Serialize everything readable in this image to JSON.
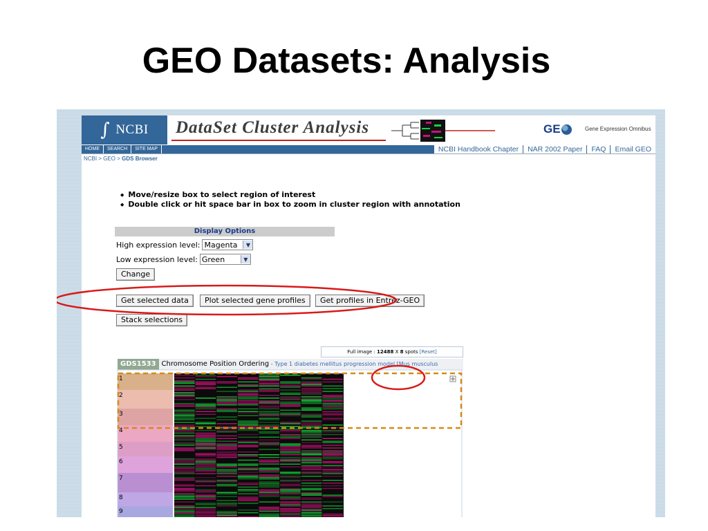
{
  "slide": {
    "title": "GEO Datasets: Analysis"
  },
  "banner": {
    "ncbi_logo": "NCBI",
    "tool_title": "DataSet Cluster Analysis",
    "geo_logo": "GE",
    "geo_subtitle": "Gene Expression Omnibus"
  },
  "nav": {
    "left": [
      "HOME",
      "SEARCH",
      "SITE MAP"
    ],
    "right": [
      "NCBI Handbook Chapter",
      "NAR 2002 Paper",
      "FAQ",
      "Email GEO"
    ]
  },
  "breadcrumb": {
    "path": "NCBI > GEO > ",
    "current": "GDS Browser"
  },
  "instructions": [
    "Move/resize box to select region of interest",
    "Double click or hit space bar in box to zoom in cluster region with annotation"
  ],
  "display_options": {
    "heading": "Display Options",
    "high_label": "High expression level:",
    "high_value": "Magenta",
    "low_label": "Low expression level:",
    "low_value": "Green",
    "change_button": "Change"
  },
  "actions": {
    "get_selected_data": "Get selected data",
    "plot_selected": "Plot selected gene profiles",
    "get_profiles": "Get profiles in Entrez-GEO",
    "stack_selections": "Stack selections"
  },
  "image_info": {
    "prefix": "Full image : ",
    "count": "12488",
    "mid": " X ",
    "cols": "8",
    "suffix": " spots ",
    "reset": "[Reset]"
  },
  "dataset": {
    "id": "GDS1533",
    "ordering": "Chromosome Position Ordering",
    "sep": " - ",
    "description": "Type 1 diabetes mellitus progression model [Mus musculus"
  },
  "chromosomes": [
    "1",
    "2",
    "3",
    "4",
    "5",
    "6",
    "7",
    "8",
    "9"
  ],
  "colors": {
    "ncbi_blue": "#336699",
    "high": "#c8127a",
    "low": "#19d23c",
    "selection_box": "#d58a17",
    "annotation": "#d81a1a"
  }
}
